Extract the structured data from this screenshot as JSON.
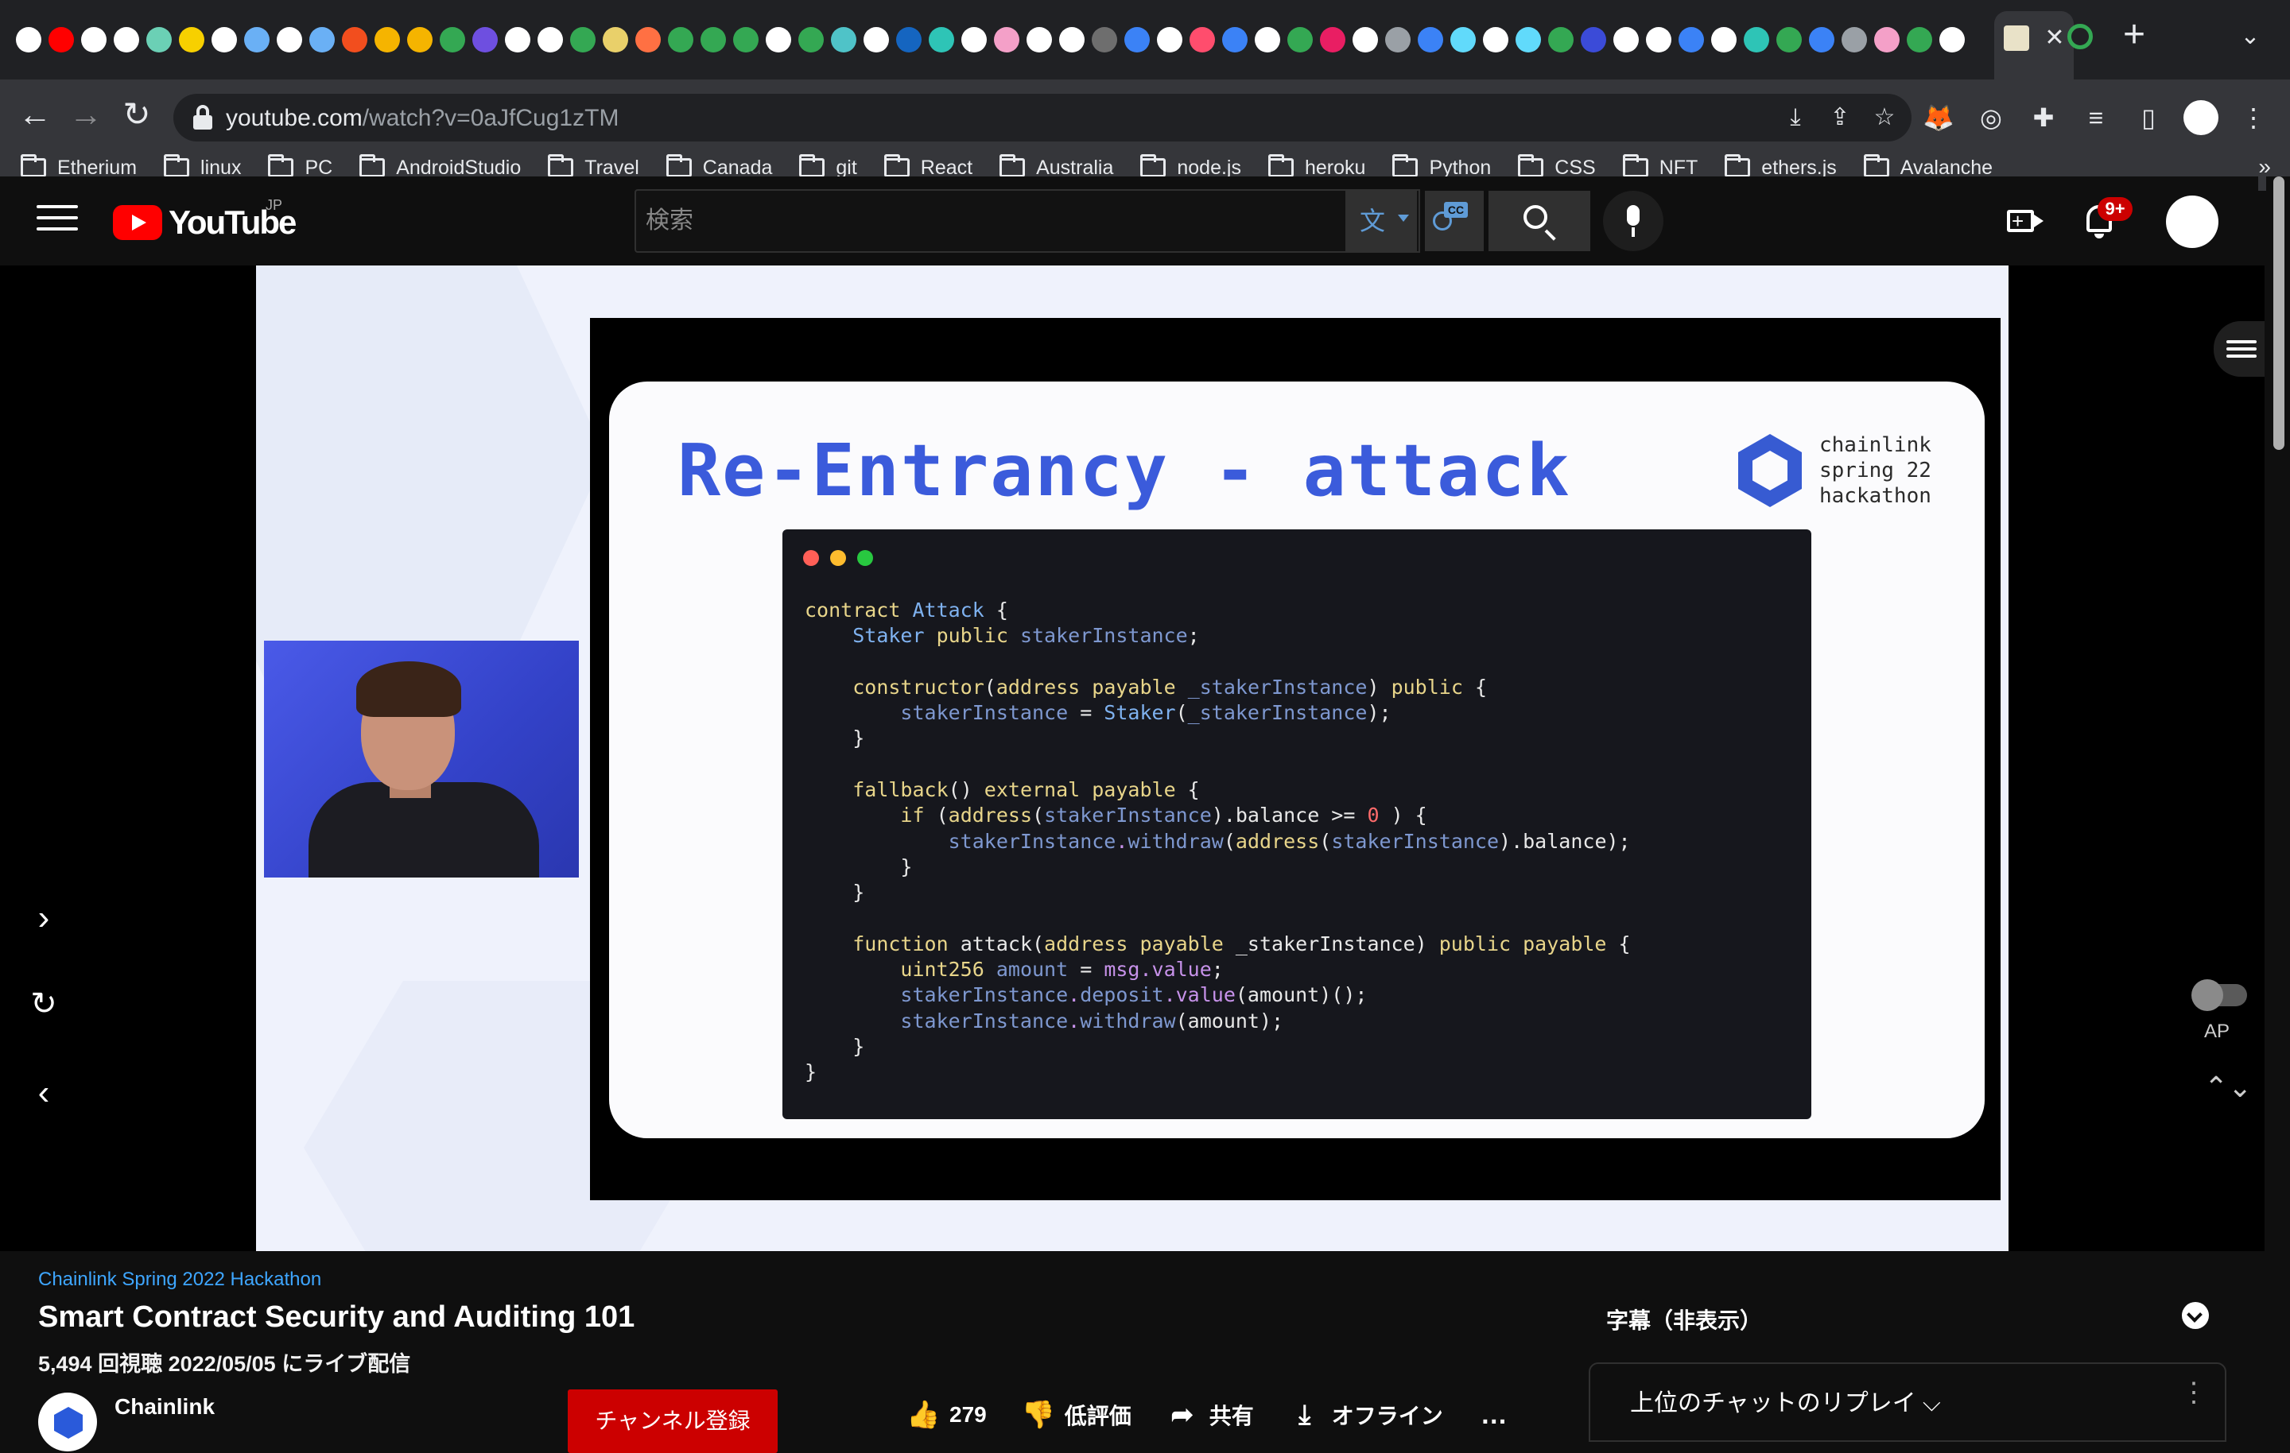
{
  "browser": {
    "tab_close_symbol": "✕",
    "new_tab_symbol": "+",
    "tab_search_symbol": "⌄",
    "nav": {
      "back": "←",
      "forward": "→",
      "reload": "↻"
    },
    "url_host": "youtube.com",
    "url_path": "/watch?v=0aJfCug1zTM",
    "omnibox_actions": [
      {
        "icon": "install-app-icon",
        "glyph": "⤓"
      },
      {
        "icon": "share-icon",
        "glyph": "⇪"
      },
      {
        "icon": "bookmark-star-icon",
        "glyph": "☆"
      }
    ],
    "extensions": [
      {
        "icon": "metamask-fox-icon",
        "glyph": "🦊"
      },
      {
        "icon": "target-extension-icon",
        "glyph": "◎"
      },
      {
        "icon": "puzzle-extensions-icon",
        "glyph": "✚"
      },
      {
        "icon": "media-queue-icon",
        "glyph": "≡"
      },
      {
        "icon": "side-panel-icon",
        "glyph": "▯"
      }
    ],
    "menu_glyph": "⋮",
    "bookmarks": [
      "Etherium",
      "linux",
      "PC",
      "AndroidStudio",
      "Travel",
      "Canada",
      "git",
      "React",
      "Australia",
      "node.js",
      "heroku",
      "Python",
      "CSS",
      "NFT",
      "ethers.js",
      "Avalanche"
    ],
    "bookmarks_more": "»",
    "favicon_colors": [
      "#ffffff",
      "#ff0000",
      "#ffffff",
      "#ffffff",
      "#6bd0b5",
      "#f7d000",
      "#ffffff",
      "#6ab0f5",
      "#ffffff",
      "#6ab0f5",
      "#f24e1e",
      "#f5b400",
      "#f5b400",
      "#34a853",
      "#6e4fe0",
      "#ffffff",
      "#ffffff",
      "#34a853",
      "#e9d06a",
      "#ff7043",
      "#34a853",
      "#34a853",
      "#34a853",
      "#ffffff",
      "#34a853",
      "#4fc3c8",
      "#ffffff",
      "#1565c0",
      "#2ec4b6",
      "#ffffff",
      "#f4a0c8",
      "#ffffff",
      "#ffffff",
      "#6e6e6e",
      "#3b82f6",
      "#ffffff",
      "#ff4d6d",
      "#3b82f6",
      "#ffffff",
      "#34a853",
      "#e91e63",
      "#ffffff",
      "#9aa0a6",
      "#3b82f6",
      "#61dafb",
      "#ffffff",
      "#61dafb",
      "#34a853",
      "#3b4bd8",
      "#ffffff",
      "#ffffff",
      "#3b82f6",
      "#ffffff",
      "#2ec4b6",
      "#34a853",
      "#3b82f6",
      "#9aa0a6",
      "#f4a0c8",
      "#34a853",
      "#ffffff"
    ]
  },
  "youtube": {
    "logo_text": "YouTube",
    "region": "JP",
    "search_placeholder": "検索",
    "ime_glyph": "文",
    "cc_badge": "CC",
    "notification_count": "9+"
  },
  "player": {
    "slide": {
      "title": "Re-Entrancy - attack",
      "brand": "chainlink\nspring 22\nhackathon",
      "code_lines": [
        [
          [
            "kw",
            "contract "
          ],
          [
            "ty",
            "Attack"
          ],
          [
            "pl",
            " {"
          ]
        ],
        [
          [
            "pl",
            "    "
          ],
          [
            "ty",
            "Staker "
          ],
          [
            "kw",
            "public "
          ],
          [
            "nm",
            "stakerInstance"
          ],
          [
            "pl",
            ";"
          ]
        ],
        [
          [
            "pl",
            ""
          ]
        ],
        [
          [
            "pl",
            "    "
          ],
          [
            "kw",
            "constructor"
          ],
          [
            "pl",
            "("
          ],
          [
            "kw",
            "address payable "
          ],
          [
            "nm",
            "_stakerInstance"
          ],
          [
            "pl",
            ") "
          ],
          [
            "kw",
            "public"
          ],
          [
            "pl",
            " {"
          ]
        ],
        [
          [
            "pl",
            "        "
          ],
          [
            "nm",
            "stakerInstance"
          ],
          [
            "pl",
            " = "
          ],
          [
            "ty",
            "Staker"
          ],
          [
            "pl",
            "("
          ],
          [
            "nm",
            "_stakerInstance"
          ],
          [
            "pl",
            ");"
          ]
        ],
        [
          [
            "pl",
            "    }"
          ]
        ],
        [
          [
            "pl",
            ""
          ]
        ],
        [
          [
            "pl",
            "    "
          ],
          [
            "kw",
            "fallback"
          ],
          [
            "pl",
            "() "
          ],
          [
            "kw",
            "external payable"
          ],
          [
            "pl",
            " {"
          ]
        ],
        [
          [
            "pl",
            "        "
          ],
          [
            "kw",
            "if"
          ],
          [
            "pl",
            " ("
          ],
          [
            "kw",
            "address"
          ],
          [
            "pl",
            "("
          ],
          [
            "nm",
            "stakerInstance"
          ],
          [
            "pl",
            ").balance >= "
          ],
          [
            "nu",
            "0"
          ],
          [
            "pl",
            " ) {"
          ]
        ],
        [
          [
            "pl",
            "            "
          ],
          [
            "nm",
            "stakerInstance"
          ],
          [
            "ac",
            "."
          ],
          [
            "nm",
            "withdraw"
          ],
          [
            "pl",
            "("
          ],
          [
            "kw",
            "address"
          ],
          [
            "pl",
            "("
          ],
          [
            "nm",
            "stakerInstance"
          ],
          [
            "pl",
            ").balance);"
          ]
        ],
        [
          [
            "pl",
            "        }"
          ]
        ],
        [
          [
            "pl",
            "    }"
          ]
        ],
        [
          [
            "pl",
            ""
          ]
        ],
        [
          [
            "pl",
            "    "
          ],
          [
            "kw",
            "function "
          ],
          [
            "pl",
            "attack("
          ],
          [
            "kw",
            "address payable "
          ],
          [
            "pl",
            "_stakerInstance) "
          ],
          [
            "kw",
            "public payable"
          ],
          [
            "pl",
            " {"
          ]
        ],
        [
          [
            "pl",
            "        "
          ],
          [
            "kw",
            "uint256 "
          ],
          [
            "nm",
            "amount"
          ],
          [
            "pl",
            " = "
          ],
          [
            "ac",
            "msg.value"
          ],
          [
            "pl",
            ";"
          ]
        ],
        [
          [
            "pl",
            "        "
          ],
          [
            "nm",
            "stakerInstance"
          ],
          [
            "ac",
            "."
          ],
          [
            "nm",
            "deposit"
          ],
          [
            "ac",
            ".value"
          ],
          [
            "pl",
            "(amount)();"
          ]
        ],
        [
          [
            "pl",
            "        "
          ],
          [
            "nm",
            "stakerInstance"
          ],
          [
            "ac",
            "."
          ],
          [
            "nm",
            "withdraw"
          ],
          [
            "pl",
            "(amount);"
          ]
        ],
        [
          [
            "pl",
            "    }"
          ]
        ],
        [
          [
            "pl",
            "}"
          ]
        ]
      ],
      "window_dots": [
        "#ff5f57",
        "#febc2e",
        "#28c840"
      ]
    },
    "side_controls": {
      "next": "›",
      "replay": "↻",
      "prev": "‹"
    },
    "autoplay_label": "AP",
    "size_toggle": "⌃⌄"
  },
  "video": {
    "series": "Chainlink Spring 2022 Hackathon",
    "title": "Smart Contract Security and Auditing 101",
    "meta": "5,494 回視聴  2022/05/05 にライブ配信",
    "channel": "Chainlink",
    "subscribe": "チャンネル登録",
    "actions": [
      {
        "icon": "thumbs-up-icon",
        "glyph": "👍",
        "label": "279"
      },
      {
        "icon": "thumbs-down-icon",
        "glyph": "👎",
        "label": "低評価"
      },
      {
        "icon": "share-arrow-icon",
        "glyph": "➦",
        "label": "共有"
      },
      {
        "icon": "download-icon",
        "glyph": "⤓",
        "label": "オフライン"
      },
      {
        "icon": "more-horizontal-icon",
        "glyph": "…",
        "label": ""
      }
    ]
  },
  "chat": {
    "captions_label": "字幕（非表示）",
    "mode_label": "上位のチャットのリプレイ ⌵",
    "more_glyph": "⋮"
  }
}
